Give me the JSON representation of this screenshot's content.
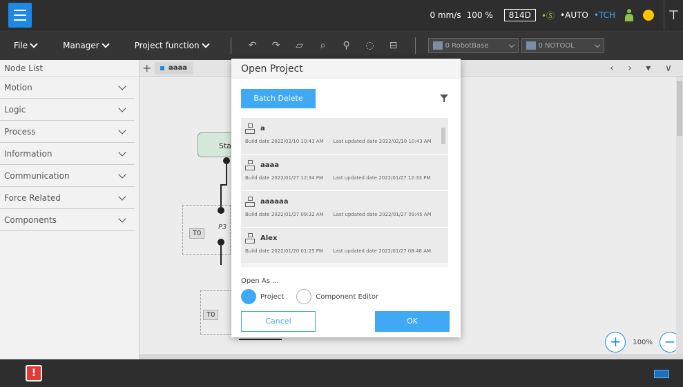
{
  "status": {
    "speed": "0 mm/s",
    "override": "100 %",
    "code": "814D",
    "safety": "•Ⓢ",
    "mode": "•AUTO",
    "frame": "•TCH"
  },
  "toolbar": {
    "file": "File",
    "manager": "Manager",
    "project_function": "Project function",
    "robot_base": "0 RobotBase",
    "tool": "0 NOTOOL"
  },
  "sidebar": {
    "header": "Node List",
    "items": [
      {
        "label": "Motion"
      },
      {
        "label": "Logic"
      },
      {
        "label": "Process"
      },
      {
        "label": "Information"
      },
      {
        "label": "Communication"
      },
      {
        "label": "Force Related"
      },
      {
        "label": "Components"
      }
    ]
  },
  "canvas": {
    "tab_name": "aaaa",
    "start_label": "Sta",
    "point_label": "P3",
    "t0_label_1": "T0",
    "t0_label_2": "T0",
    "zoom": "100%"
  },
  "dialog": {
    "title": "Open Project",
    "batch_delete": "Batch Delete",
    "build_label": "Build date",
    "updated_label": "Last updated date",
    "projects": [
      {
        "name": "a",
        "build": "2022/02/10 10:43 AM",
        "updated": "2022/02/10 10:43 AM"
      },
      {
        "name": "aaaa",
        "build": "2022/01/27 12:34 PM",
        "updated": "2022/01/27 12:33 PM"
      },
      {
        "name": "aaaaaa",
        "build": "2022/01/27 09:32 AM",
        "updated": "2022/01/27 09:45 AM"
      },
      {
        "name": "Alex",
        "build": "2022/01/20 01:25 PM",
        "updated": "2022/01/27 08:48 AM"
      }
    ],
    "open_as": "Open As ...",
    "option_project": "Project",
    "option_component": "Component Editor",
    "cancel": "Cancel",
    "ok": "OK"
  },
  "colors": {
    "accent": "#3fa9f5",
    "menu_button": "#1e88e5",
    "status_green": "#8bc34a",
    "status_yellow": "#ffc600",
    "alarm": "#e53935"
  }
}
